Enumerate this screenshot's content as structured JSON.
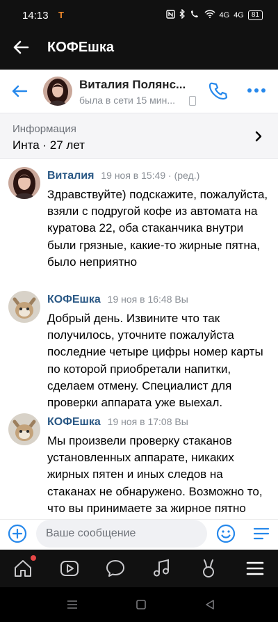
{
  "status_bar": {
    "time": "14:13",
    "carrier_badge": "T",
    "signal_1": "4G",
    "signal_2": "4G",
    "battery": "81"
  },
  "app_bar": {
    "title": "КОФЕшка"
  },
  "chat_header": {
    "name": "Виталия Полянс...",
    "status": "была в сети 15 мин..."
  },
  "info": {
    "label": "Информация",
    "value": "Инта · 27 лет"
  },
  "messages": [
    {
      "author": "Виталия",
      "time": "19 ноя в 15:49 · (ред.)",
      "text": "Здравствуйте) подскажите, пожалуйста, взяли с подругой кофе из автомата на куратова 22, оба стаканчика внутри были грязные, какие-то жирные пятна, было неприятно"
    },
    {
      "author": "КОФЕшка",
      "time": "19 ноя в 16:48  Вы",
      "text": "Добрый день. Извините что так получилось, уточните пожалуйста последние четыре цифры номер карты по которой приобретали напитки, сделаем отмену. Специалист для проверки аппарата уже выехал."
    },
    {
      "author": "КОФЕшка",
      "time": "19 ноя в 17:08  Вы",
      "text": "Мы произвели проверку стаканов установленных аппарате, никаких жирных пятен и иных следов на стаканах не обнаружено. Возможно то, что вы принимаете за жирное пятно является следами заводского"
    }
  ],
  "composer": {
    "placeholder": "Ваше сообщение"
  },
  "bottom_nav": [
    "home-icon",
    "video-icon",
    "messages-icon",
    "music-icon",
    "services-icon",
    "menu-icon"
  ],
  "colors": {
    "accent": "#2688eb",
    "author": "#2a5885",
    "dark_bar": "#111111",
    "muted": "#8a8f96"
  }
}
